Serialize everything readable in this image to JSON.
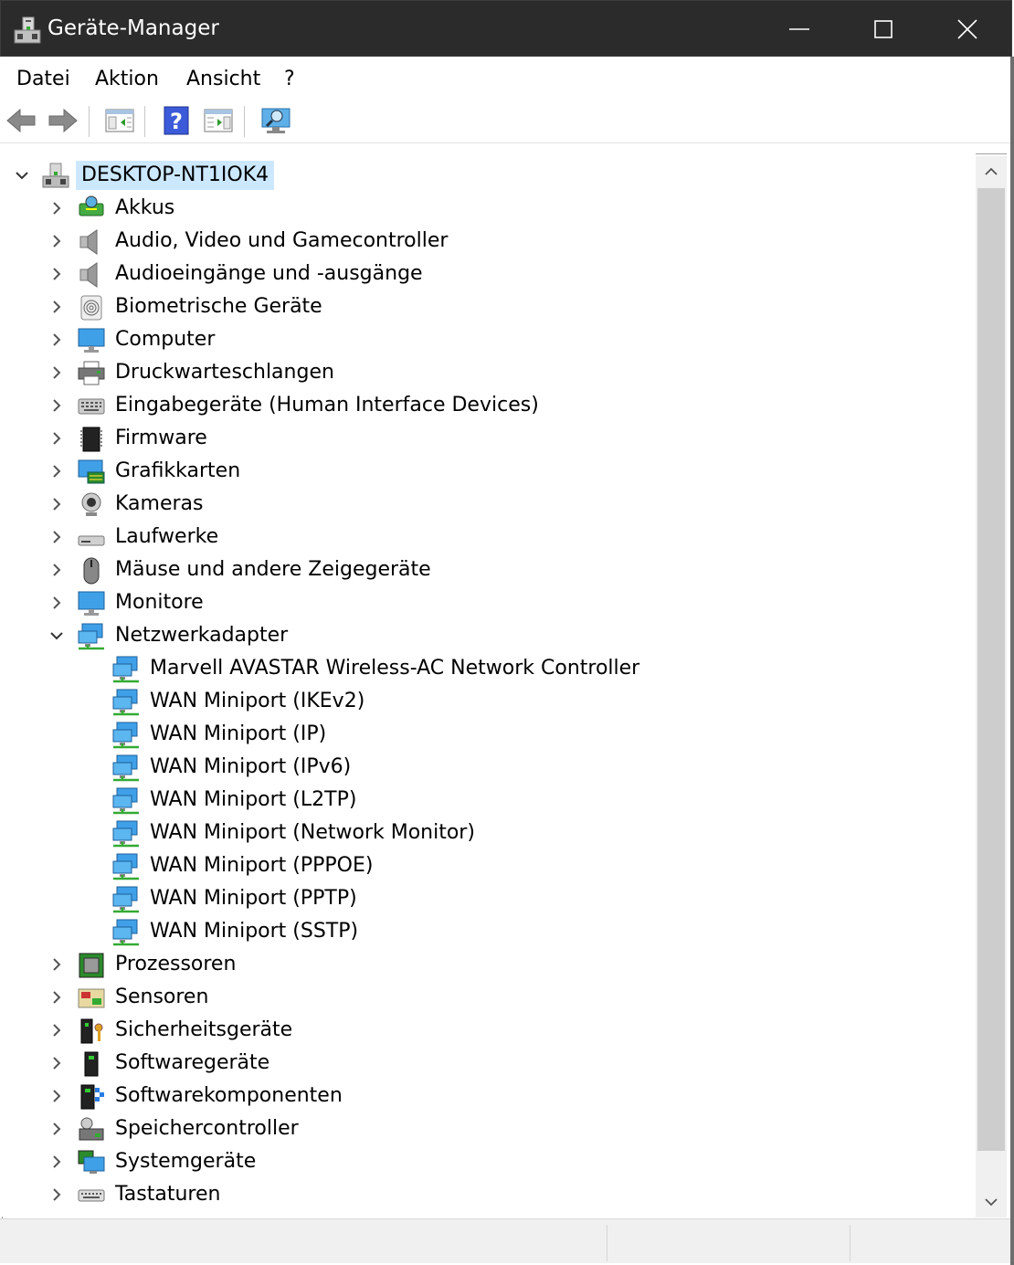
{
  "window": {
    "title": "Geräte-Manager",
    "controls": [
      "minimize",
      "maximize",
      "close"
    ]
  },
  "menu": {
    "items": [
      {
        "label": "Datei"
      },
      {
        "label": "Aktion"
      },
      {
        "label": "Ansicht"
      },
      {
        "label": "?"
      }
    ]
  },
  "toolbar": {
    "buttons": [
      "back-icon",
      "forward-icon",
      "show-hide-console-tree-icon",
      "help-icon",
      "action-pane-icon",
      "scan-hardware-icon"
    ]
  },
  "tree": {
    "root": {
      "label": "DESKTOP-NT1IOK4",
      "expanded": true,
      "selected": true
    },
    "categories": [
      {
        "label": "Akkus",
        "icon": "battery-icon",
        "expanded": false
      },
      {
        "label": "Audio, Video und Gamecontroller",
        "icon": "speaker-icon",
        "expanded": false
      },
      {
        "label": "Audioeingänge und -ausgänge",
        "icon": "speaker-icon",
        "expanded": false
      },
      {
        "label": "Biometrische Geräte",
        "icon": "fingerprint-icon",
        "expanded": false
      },
      {
        "label": "Computer",
        "icon": "computer-monitor-icon",
        "expanded": false
      },
      {
        "label": "Druckwarteschlangen",
        "icon": "printer-icon",
        "expanded": false
      },
      {
        "label": "Eingabegeräte (Human Interface Devices)",
        "icon": "hid-keyboard-icon",
        "expanded": false
      },
      {
        "label": "Firmware",
        "icon": "chip-icon",
        "expanded": false
      },
      {
        "label": "Grafikkarten",
        "icon": "display-adapter-icon",
        "expanded": false
      },
      {
        "label": "Kameras",
        "icon": "webcam-icon",
        "expanded": false
      },
      {
        "label": "Laufwerke",
        "icon": "disk-drive-icon",
        "expanded": false
      },
      {
        "label": "Mäuse und andere Zeigegeräte",
        "icon": "mouse-icon",
        "expanded": false
      },
      {
        "label": "Monitore",
        "icon": "monitor-icon",
        "expanded": false
      },
      {
        "label": "Netzwerkadapter",
        "icon": "network-adapter-icon",
        "expanded": true,
        "children": [
          {
            "label": "Marvell AVASTAR Wireless-AC Network Controller"
          },
          {
            "label": "WAN Miniport (IKEv2)"
          },
          {
            "label": "WAN Miniport (IP)"
          },
          {
            "label": "WAN Miniport (IPv6)"
          },
          {
            "label": "WAN Miniport (L2TP)"
          },
          {
            "label": "WAN Miniport (Network Monitor)"
          },
          {
            "label": "WAN Miniport (PPPOE)"
          },
          {
            "label": "WAN Miniport (PPTP)"
          },
          {
            "label": "WAN Miniport (SSTP)"
          }
        ]
      },
      {
        "label": "Prozessoren",
        "icon": "processor-icon",
        "expanded": false
      },
      {
        "label": "Sensoren",
        "icon": "sensor-icon",
        "expanded": false
      },
      {
        "label": "Sicherheitsgeräte",
        "icon": "security-device-icon",
        "expanded": false
      },
      {
        "label": "Softwaregeräte",
        "icon": "software-device-icon",
        "expanded": false
      },
      {
        "label": "Softwarekomponenten",
        "icon": "software-component-icon",
        "expanded": false
      },
      {
        "label": "Speichercontroller",
        "icon": "storage-controller-icon",
        "expanded": false
      },
      {
        "label": "Systemgeräte",
        "icon": "system-device-icon",
        "expanded": false
      },
      {
        "label": "Tastaturen",
        "icon": "keyboard-icon",
        "expanded": false
      }
    ]
  }
}
